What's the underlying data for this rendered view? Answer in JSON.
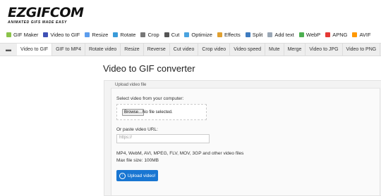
{
  "logo": {
    "main": "EZGIFCOM",
    "sub": "ANIMATED GIFS MADE EASY"
  },
  "topnav": [
    {
      "label": "GIF Maker",
      "icon": "gif-maker-icon",
      "color": "#8bc34a"
    },
    {
      "label": "Video to GIF",
      "icon": "video-to-gif-icon",
      "color": "#3f51b5"
    },
    {
      "label": "Resize",
      "icon": "resize-icon",
      "color": "#5c9ded"
    },
    {
      "label": "Rotate",
      "icon": "rotate-icon",
      "color": "#3a9bd9"
    },
    {
      "label": "Crop",
      "icon": "crop-icon",
      "color": "#777777"
    },
    {
      "label": "Cut",
      "icon": "cut-icon",
      "color": "#555555"
    },
    {
      "label": "Optimize",
      "icon": "optimize-icon",
      "color": "#4aa3df"
    },
    {
      "label": "Effects",
      "icon": "effects-icon",
      "color": "#e0a030"
    },
    {
      "label": "Split",
      "icon": "split-icon",
      "color": "#3e7bbf"
    },
    {
      "label": "Add text",
      "icon": "add-text-icon",
      "color": "#9aa7b5"
    },
    {
      "label": "WebP",
      "icon": "webp-icon",
      "color": "#4caf50"
    },
    {
      "label": "APNG",
      "icon": "apng-icon",
      "color": "#e53935"
    },
    {
      "label": "AVIF",
      "icon": "avif-icon",
      "color": "#ff9800"
    }
  ],
  "subnav": [
    "Video to GIF",
    "GIF to MP4",
    "Rotate video",
    "Resize",
    "Reverse",
    "Cut video",
    "Crop video",
    "Video speed",
    "Mute",
    "Merge",
    "Video to JPG",
    "Video to PNG"
  ],
  "page": {
    "title": "Video to GIF converter"
  },
  "upload": {
    "legend": "Upload video file",
    "select_label": "Select video from your computer:",
    "browse_label": "Browse...",
    "no_file": "No file selected.",
    "url_label": "Or paste video URL:",
    "url_placeholder": "https://",
    "formats": "MP4, WebM, AVI, MPEG, FLV, MOV, 3GP and other video files",
    "max_size": "Max file size: 100MB",
    "button_label": "Upload video!"
  }
}
